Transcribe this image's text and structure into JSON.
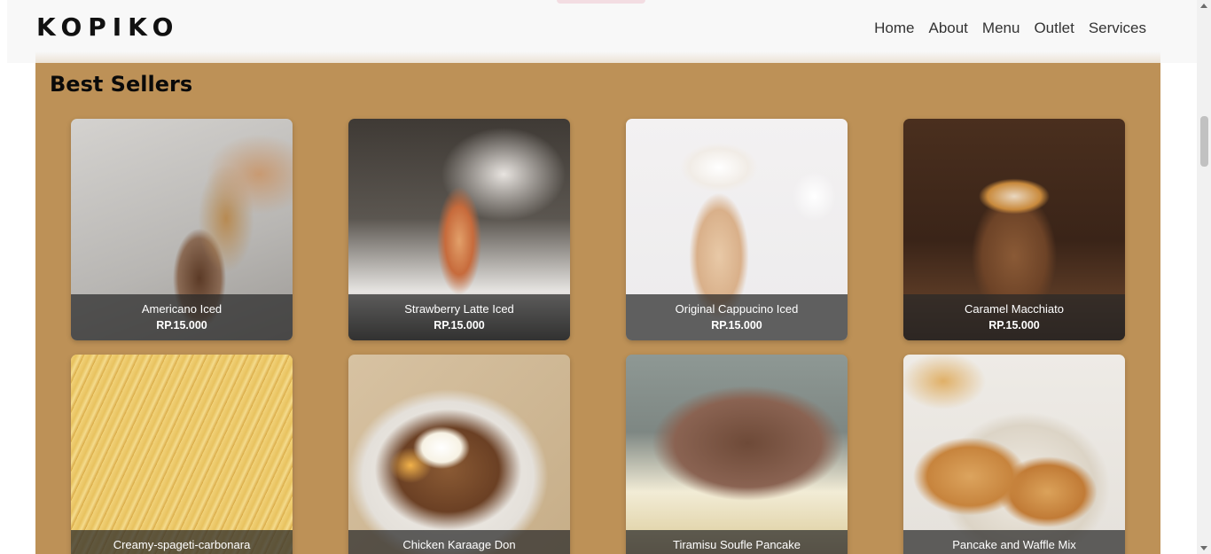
{
  "brand": {
    "logo": "KOPIKO"
  },
  "nav": {
    "items": [
      "Home",
      "About",
      "Menu",
      "Outlet",
      "Services"
    ]
  },
  "section": {
    "title": "Best Sellers"
  },
  "products": [
    {
      "name": "Americano Iced",
      "price": "RP.15.000"
    },
    {
      "name": "Strawberry Latte Iced",
      "price": "RP.15.000"
    },
    {
      "name": "Original Cappucino Iced",
      "price": "RP.15.000"
    },
    {
      "name": "Caramel Macchiato",
      "price": "RP.15.000"
    },
    {
      "name": "Creamy-spageti-carbonara",
      "price": ""
    },
    {
      "name": "Chicken Karaage Don",
      "price": ""
    },
    {
      "name": "Tiramisu Soufle Pancake",
      "price": ""
    },
    {
      "name": "Pancake and Waffle Mix",
      "price": ""
    }
  ],
  "colors": {
    "section_bg": "#bd9157",
    "header_bg": "#f8f8f8",
    "caption_bg": "#282828"
  }
}
